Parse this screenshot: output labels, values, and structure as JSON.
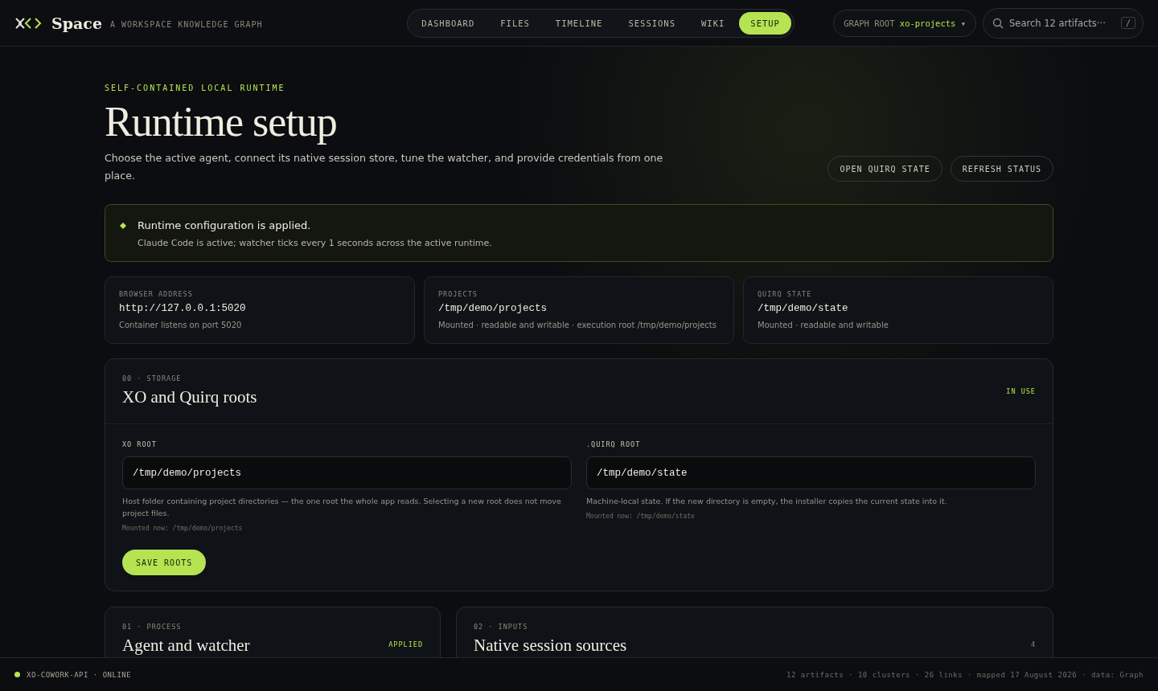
{
  "brand": {
    "name": "Space",
    "tagline": "A WORKSPACE KNOWLEDGE GRAPH"
  },
  "nav": [
    {
      "label": "DASHBOARD",
      "selected": false
    },
    {
      "label": "FILES",
      "selected": false
    },
    {
      "label": "TIMELINE",
      "selected": false
    },
    {
      "label": "SESSIONS",
      "selected": false
    },
    {
      "label": "WIKI",
      "selected": false
    },
    {
      "label": "SETUP",
      "selected": true
    }
  ],
  "graph_root": {
    "label": "GRAPH ROOT",
    "value": "xo-projects",
    "caret": "▾"
  },
  "search": {
    "placeholder": "Search 12 artifacts···",
    "shortcut": "/"
  },
  "hero": {
    "eyebrow": "SELF-CONTAINED LOCAL RUNTIME",
    "title": "Runtime setup",
    "description": "Choose the active agent, connect its native session store, tune the watcher, and provide credentials from one place.",
    "actions": [
      "OPEN QUIRQ STATE",
      "REFRESH STATUS"
    ]
  },
  "alert": {
    "title": "Runtime configuration is applied.",
    "detail": "Claude Code is active; watcher ticks every 1 seconds across the active runtime."
  },
  "info_cards": [
    {
      "label": "BROWSER ADDRESS",
      "value": "http://127.0.0.1:5020",
      "note": "Container listens on port 5020"
    },
    {
      "label": "PROJECTS",
      "value": "/tmp/demo/projects",
      "note": "Mounted · readable and writable · execution root /tmp/demo/projects"
    },
    {
      "label": "QUIRQ STATE",
      "value": "/tmp/demo/state",
      "note": "Mounted · readable and writable"
    }
  ],
  "storage": {
    "eyebrow": "00 · STORAGE",
    "title": "XO and Quirq roots",
    "status": "IN USE",
    "fields": [
      {
        "label": "XO ROOT",
        "value": "/tmp/demo/projects",
        "help": "Host folder containing project directories — the one root the whole app reads. Selecting a new root does not move project files.",
        "mounted": "Mounted now: /tmp/demo/projects"
      },
      {
        "label": ".QUIRQ ROOT",
        "value": "/tmp/demo/state",
        "help": "Machine-local state. If the new directory is empty, the installer copies the current state into it.",
        "mounted": "Mounted now: /tmp/demo/state"
      }
    ],
    "button": "SAVE ROOTS"
  },
  "sections": [
    {
      "eyebrow": "01 · PROCESS",
      "title": "Agent and watcher",
      "status": "APPLIED"
    },
    {
      "eyebrow": "02 · INPUTS",
      "title": "Native session sources",
      "status": "4"
    }
  ],
  "status_bar": {
    "service": "XO-COWORK-API · ONLINE",
    "online": true,
    "summary": "12 artifacts · 10 clusters · 26 links · mapped 17 August 2026 · data: Graph"
  }
}
